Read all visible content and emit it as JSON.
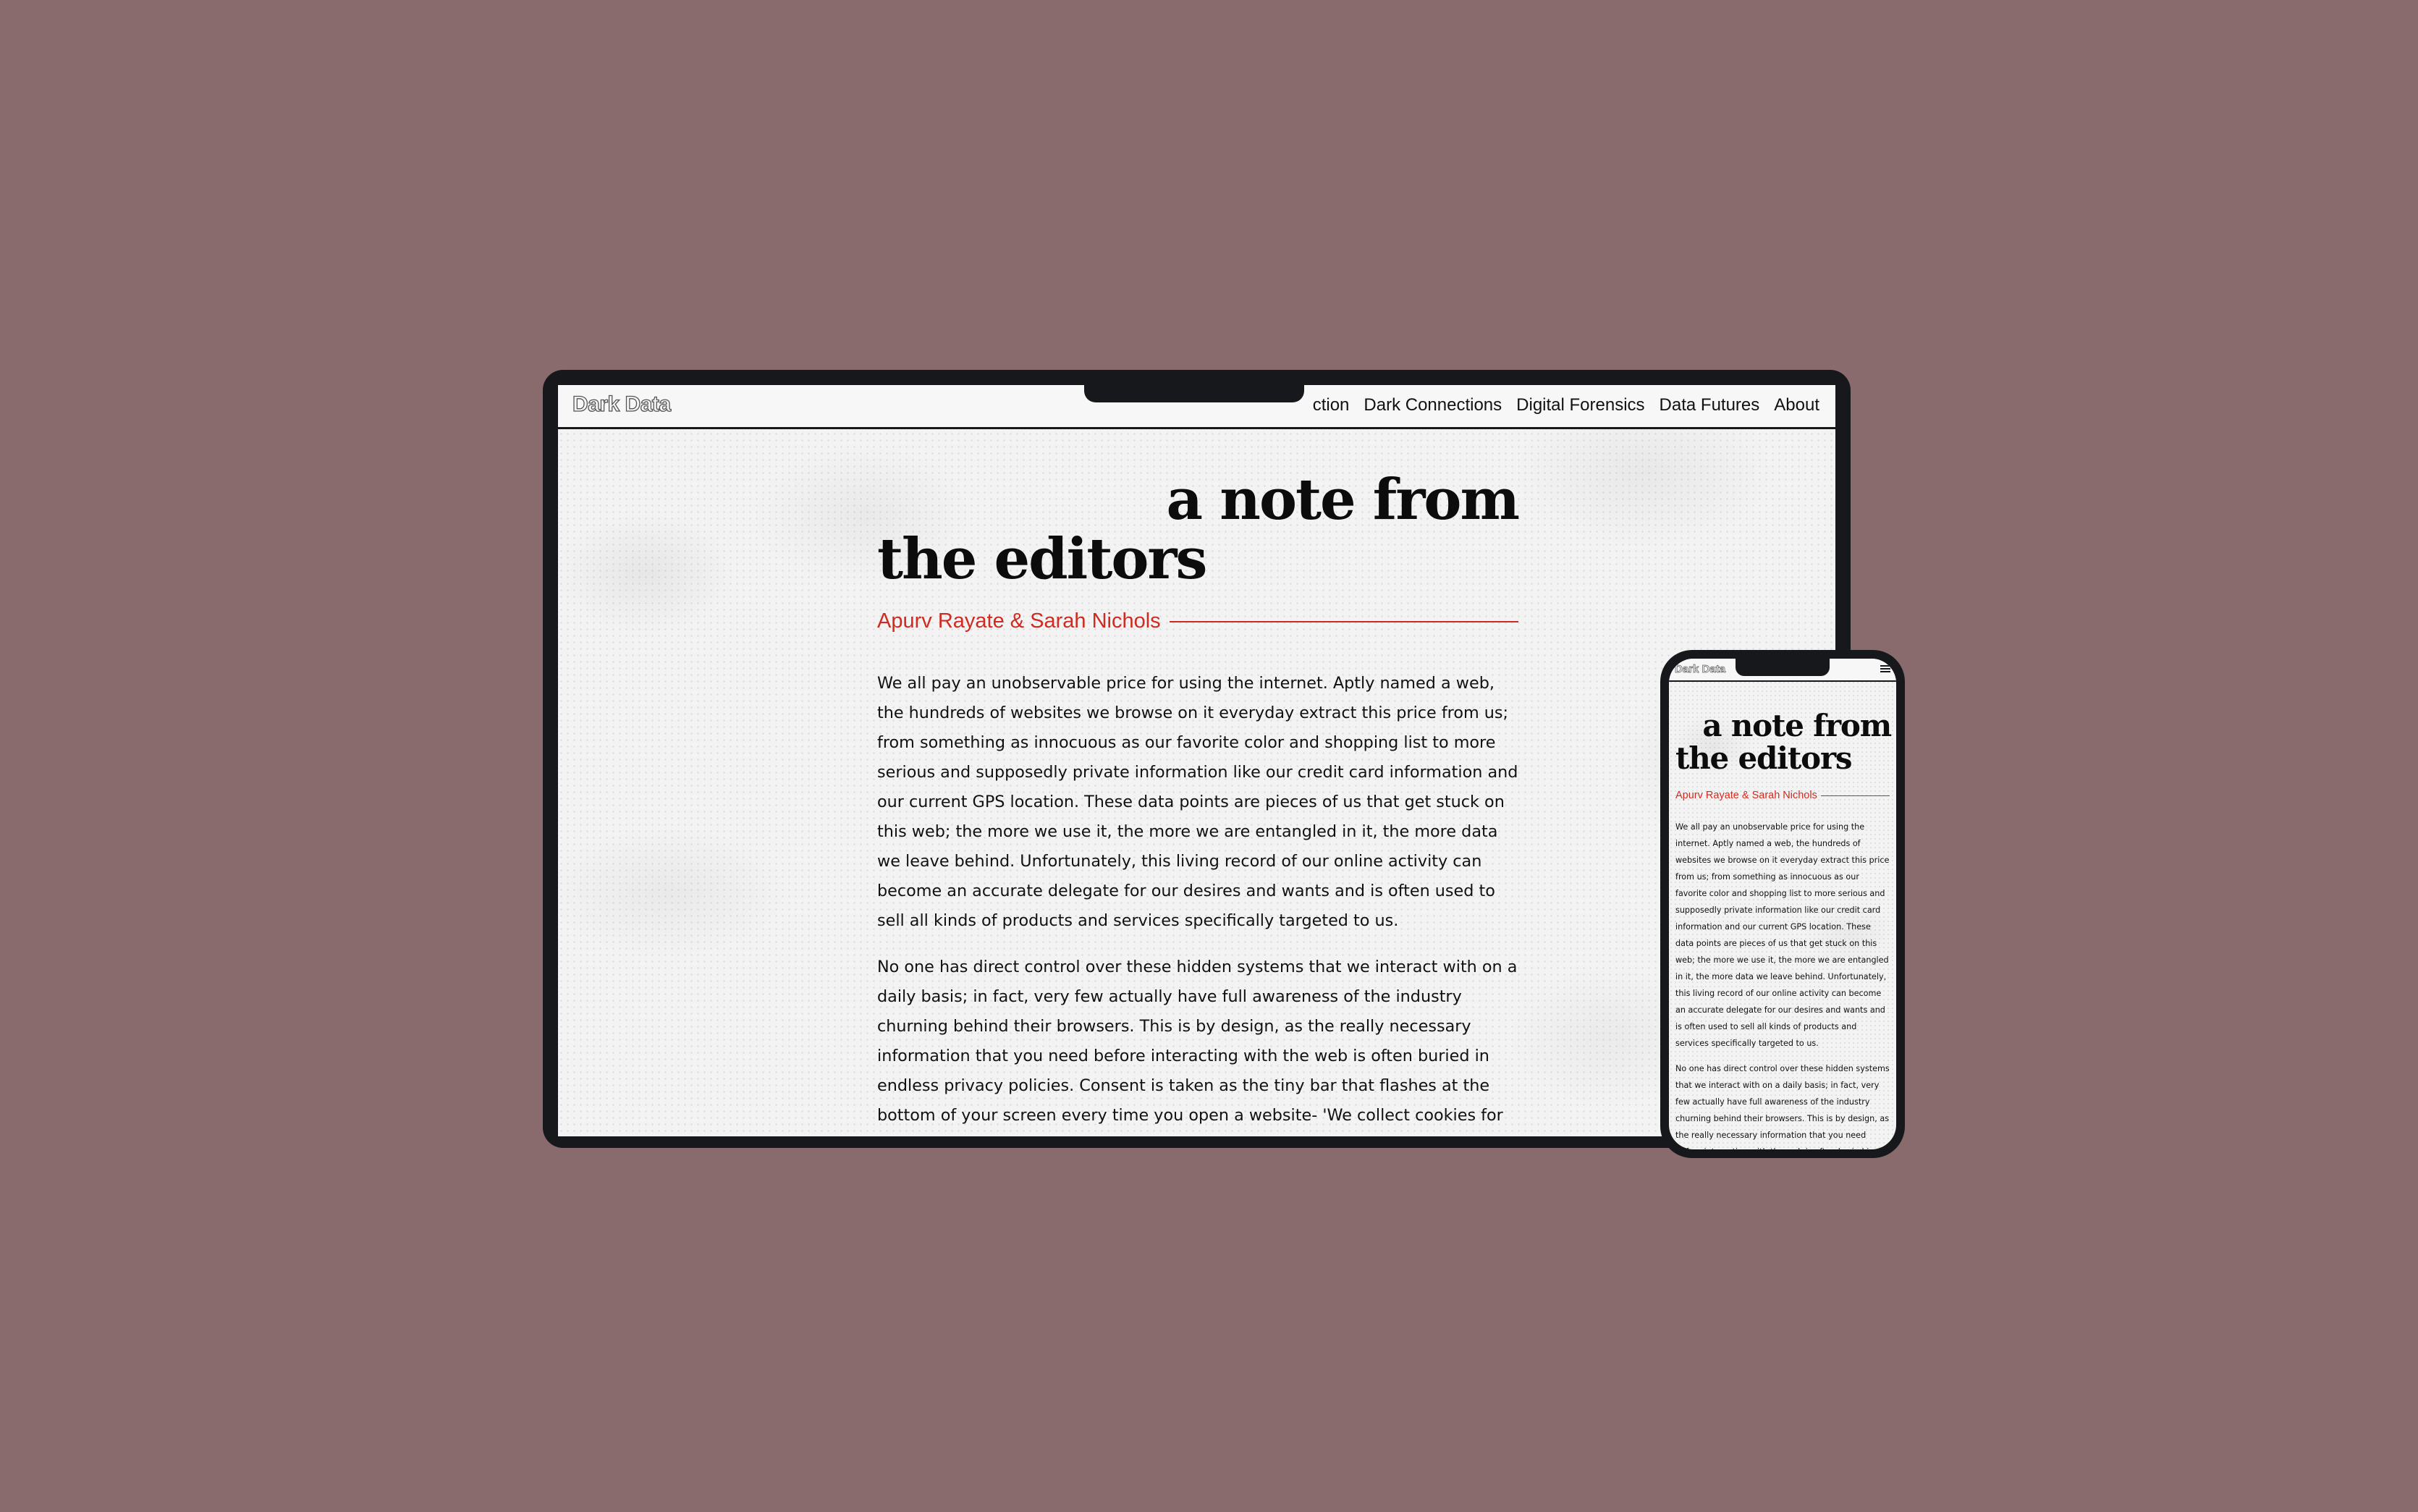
{
  "site": {
    "logo": "Dark Data",
    "nav_items": [
      {
        "label": "ction"
      },
      {
        "label": "Dark Connections"
      },
      {
        "label": "Digital Forensics"
      },
      {
        "label": "Data Futures"
      },
      {
        "label": "About"
      }
    ],
    "menu_icon": "hamburger-menu-icon"
  },
  "article": {
    "title_line1": "a note from",
    "title_line2": "the editors",
    "authors": "Apurv Rayate & Sarah Nichols",
    "paragraphs": [
      "We all pay an unobservable price for using the internet. Aptly named a web, the hundreds of websites we browse on it everyday extract this price from us; from something as innocuous as our favorite color and shopping list to more serious and supposedly private information like our credit card information and our current GPS location. These data points are pieces of us that get stuck on this web; the more we use it, the more we are entangled in it, the more data we leave behind. Unfortunately, this living record of our online activity can become an accurate delegate for our desires and wants and is often used to sell all kinds of products and services specifically targeted to us.",
      "No one has direct control over these hidden systems that we interact with on a daily basis; in fact, very few actually have full awareness of the industry churning behind their browsers. This is by design, as the really necessary information that you need before interacting with the web is often buried in endless privacy policies. Consent is taken as the tiny bar that flashes at the bottom of your screen every time you open a website- 'We collect cookies for"
    ]
  },
  "colors": {
    "background": "#896b6e",
    "device_frame": "#17181c",
    "accent_red": "#d02b20",
    "page_bg": "#f3f3f3"
  }
}
